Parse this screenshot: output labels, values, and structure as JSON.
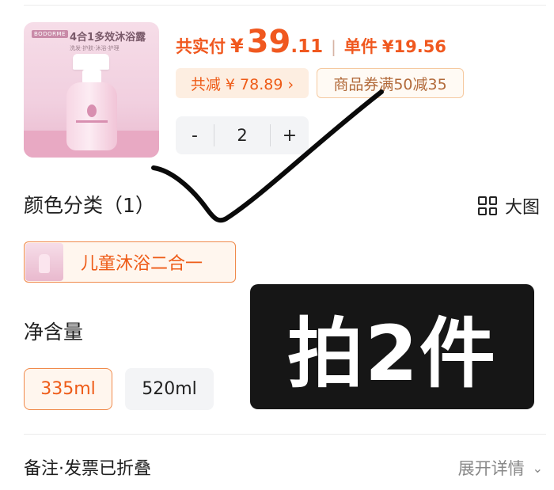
{
  "product": {
    "thumb_brand": "BODORME",
    "thumb_title": "4合1多效沐浴露",
    "thumb_subtitle": "洗发·护肤·沐浴·护理"
  },
  "price": {
    "label": "共实付",
    "yen": "¥",
    "integer": "39",
    "decimal": ".11",
    "separator": "|",
    "unit_label": "单件",
    "unit_value": "¥19.56"
  },
  "discount": {
    "total_saved": "共减 ¥ 78.89 ›",
    "coupon": "商品券满50减35"
  },
  "quantity": {
    "minus": "-",
    "value": "2",
    "plus": "+"
  },
  "color_section": {
    "title": "颜色分类（1）",
    "big_picture_label": "大图",
    "selected_variant": "儿童沐浴二合一"
  },
  "volume_section": {
    "title": "净含量",
    "options": [
      "335ml",
      "520ml"
    ],
    "selected": "335ml"
  },
  "overlay_text": "拍2件",
  "footer": {
    "remark": "备注·发票已折叠",
    "expand": "展开详情",
    "expand_chevron": "⌄"
  },
  "colors": {
    "accent": "#f0581f",
    "selected_bg": "#fff6ee",
    "overlay_bg": "#161616"
  }
}
